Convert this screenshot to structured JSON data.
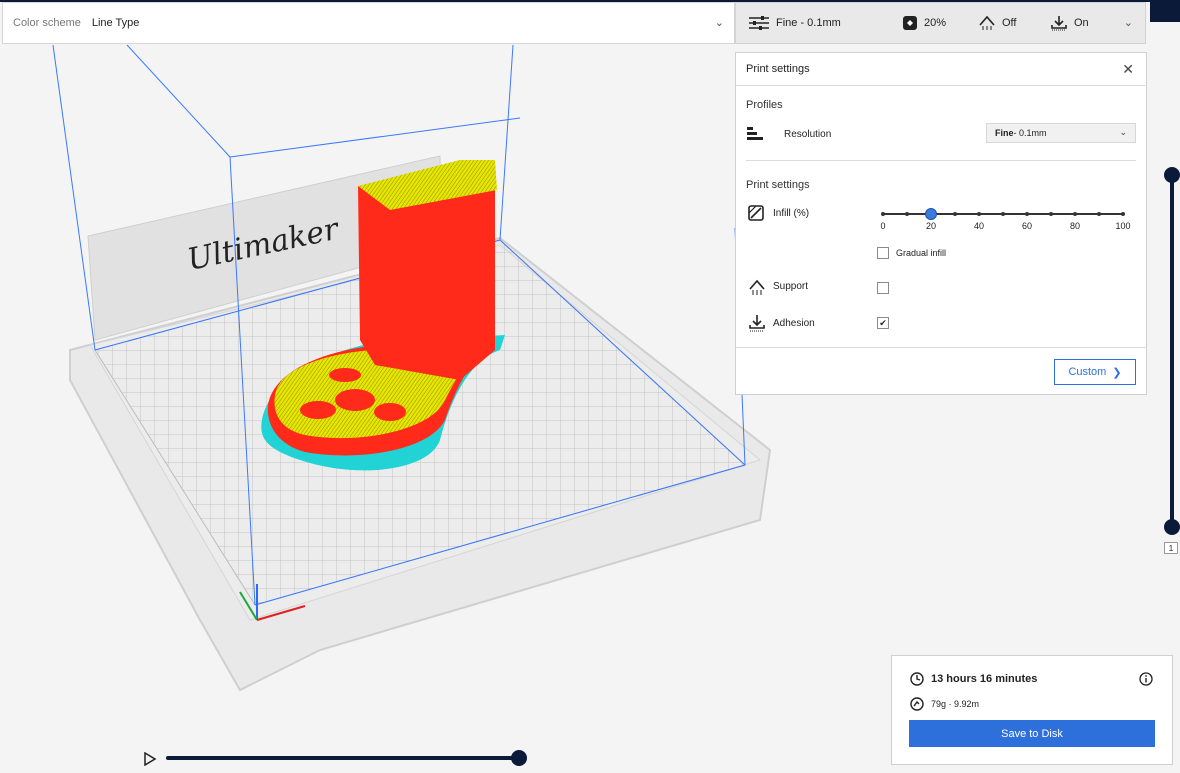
{
  "colors": {
    "accent": "#2d6fdb",
    "model_wall": "#ff2a1a",
    "model_infill": "#e6e600",
    "brim": "#22d3d6",
    "build_volume_line": "#3a79ff",
    "dark_navy": "#0c1a3a"
  },
  "viewport": {
    "printer_brand_text": "Ultimaker",
    "icons": [
      "axis-gizmo-icon"
    ]
  },
  "color_scheme": {
    "label": "Color scheme",
    "value": "Line Type",
    "icon": "chevron-down-icon"
  },
  "print_setup": {
    "profile": "Fine - 0.1mm",
    "infill": "20%",
    "support": "Off",
    "adhesion": "On",
    "icons": [
      "sliders-icon",
      "infill-icon",
      "support-icon",
      "adhesion-icon",
      "chevron-down-icon"
    ]
  },
  "panel": {
    "title": "Print settings",
    "close_icon": "close-icon",
    "profiles_label": "Profiles",
    "resolution_label": "Resolution",
    "resolution_bold": "Fine",
    "resolution_rest": " - 0.1mm",
    "settings_label": "Print settings",
    "infill_label": "Infill (%)",
    "infill_value_pct": 20,
    "infill_ticks": [
      "0",
      "20",
      "40",
      "60",
      "80",
      "100"
    ],
    "gradual_infill_label": "Gradual infill",
    "gradual_infill_checked": false,
    "support_label": "Support",
    "support_checked": false,
    "adhesion_label": "Adhesion",
    "adhesion_checked": true,
    "custom_button": "Custom"
  },
  "estimate": {
    "time": "13 hours 16 minutes",
    "material": "79g · 9.92m",
    "save_button": "Save to Disk"
  },
  "layer_view": {
    "current_layer": "1"
  }
}
